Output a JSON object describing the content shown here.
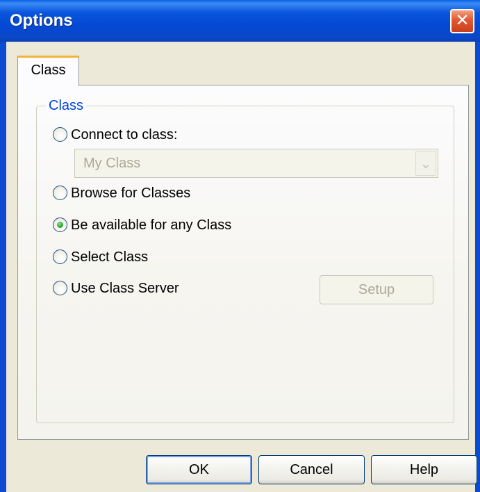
{
  "window": {
    "title": "Options",
    "close_glyph": "✕"
  },
  "tabs": [
    {
      "label": "Class",
      "selected": true
    }
  ],
  "group": {
    "label": "Class"
  },
  "options": [
    {
      "label": "Connect to class:",
      "checked": false
    },
    {
      "label": "Browse for Classes",
      "checked": false
    },
    {
      "label": "Be available for any Class",
      "checked": true
    },
    {
      "label": "Select Class",
      "checked": false
    },
    {
      "label": "Use Class Server",
      "checked": false
    }
  ],
  "class_select": {
    "value": "My Class",
    "enabled": false,
    "arrow_glyph": "⌄"
  },
  "setup_button": {
    "label": "Setup",
    "enabled": false
  },
  "buttons": {
    "ok": "OK",
    "cancel": "Cancel",
    "help": "Help"
  },
  "colors": {
    "titlebar": "#0a55dd",
    "group_label": "#0046d5",
    "tab_highlight": "#f4b23a",
    "radio_selected": "#2aa62a"
  }
}
